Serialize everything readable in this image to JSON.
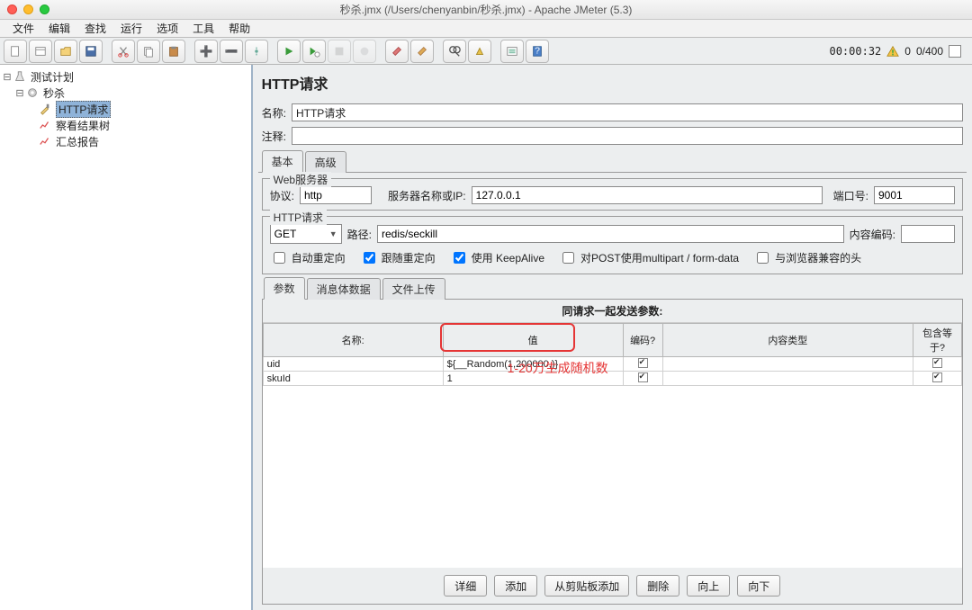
{
  "window": {
    "title": "秒杀.jmx (/Users/chenyanbin/秒杀.jmx) - Apache JMeter (5.3)"
  },
  "menu": {
    "file": "文件",
    "edit": "编辑",
    "search": "查找",
    "run": "运行",
    "options": "选项",
    "tools": "工具",
    "help": "帮助"
  },
  "timer": {
    "elapsed": "00:00:32",
    "errors": "0",
    "threads": "0/400"
  },
  "tree": {
    "root": "测试计划",
    "group": "秒杀",
    "sampler": "HTTP请求",
    "listener1": "察看结果树",
    "listener2": "汇总报告"
  },
  "panel": {
    "heading": "HTTP请求",
    "name_label": "名称:",
    "name_value": "HTTP请求",
    "comment_label": "注释:",
    "comment_value": "",
    "tab_basic": "基本",
    "tab_advanced": "高级",
    "webserver_legend": "Web服务器",
    "protocol_label": "协议:",
    "protocol_value": "http",
    "server_label": "服务器名称或IP:",
    "server_value": "127.0.0.1",
    "port_label": "端口号:",
    "port_value": "9001",
    "httpreq_legend": "HTTP请求",
    "method_value": "GET",
    "path_label": "路径:",
    "path_value": "redis/seckill",
    "enc_label": "内容编码:",
    "enc_value": "",
    "chk_auto": "自动重定向",
    "chk_follow": "跟随重定向",
    "chk_keep": "使用 KeepAlive",
    "chk_multi": "对POST使用multipart / form-data",
    "chk_compat": "与浏览器兼容的头",
    "subtab_params": "参数",
    "subtab_body": "消息体数据",
    "subtab_file": "文件上传",
    "params_title": "同请求一起发送参数:",
    "col_name": "名称:",
    "col_value": "值",
    "col_encode": "编码?",
    "col_ctype": "内容类型",
    "col_equals": "包含等于?",
    "rows": [
      {
        "name": "uid",
        "value": "${__Random(1,200000,)}",
        "encode": true,
        "ctype": "",
        "equals": true
      },
      {
        "name": "skuId",
        "value": "1",
        "encode": true,
        "ctype": "",
        "equals": true
      }
    ],
    "btn_detail": "详细",
    "btn_add": "添加",
    "btn_clip": "从剪贴板添加",
    "btn_del": "删除",
    "btn_up": "向上",
    "btn_down": "向下"
  },
  "annotation": {
    "text": "1-20万生成随机数"
  }
}
